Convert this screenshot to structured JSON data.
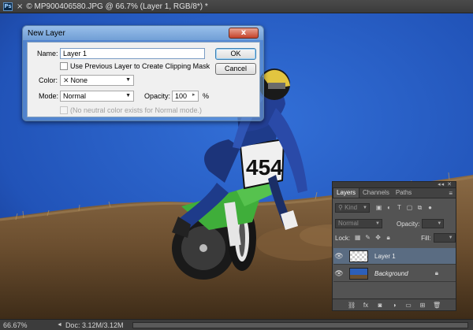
{
  "document": {
    "title": "© MP900406580.JPG @ 66.7% (Layer 1, RGB/8*) *",
    "close_glyph": "×"
  },
  "status": {
    "zoom": "66.67%",
    "doc_info": "Doc: 3.12M/3.12M"
  },
  "dialog": {
    "title": "New Layer",
    "close_glyph": "x",
    "name_label": "Name:",
    "name_value": "Layer 1",
    "clipping_label": "Use Previous Layer to Create Clipping Mask",
    "color_label": "Color:",
    "color_value": "None",
    "mode_label": "Mode:",
    "mode_value": "Normal",
    "opacity_label": "Opacity:",
    "opacity_value": "100",
    "opacity_unit": "%",
    "neutral_label": "(No neutral color exists for Normal mode.)",
    "ok_label": "OK",
    "cancel_label": "Cancel"
  },
  "layers_panel": {
    "tabs": [
      {
        "label": "Layers",
        "active": true
      },
      {
        "label": "Channels",
        "active": false
      },
      {
        "label": "Paths",
        "active": false
      }
    ],
    "filter_kind": "Kind",
    "blend_mode": "Normal",
    "opacity_label": "Opacity:",
    "lock_label": "Lock:",
    "fill_label": "Fill:",
    "layers": [
      {
        "name": "Layer 1",
        "selected": true,
        "thumb": "transparent"
      },
      {
        "name": "Background",
        "selected": false,
        "thumb": "photo",
        "locked": true
      }
    ]
  },
  "canvas": {
    "bib_number": "454",
    "colors": {
      "sky": "#2456c0",
      "dirt": "#6e5233",
      "bike_green": "#3fae3a",
      "rider_blue": "#1e3b8a"
    }
  }
}
